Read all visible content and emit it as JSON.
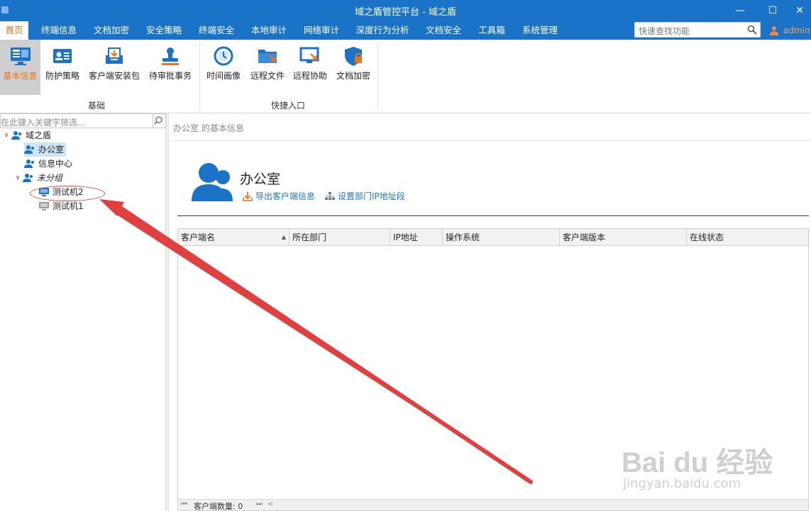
{
  "window": {
    "title": "域之盾管控平台 - 域之盾",
    "minimize": "—",
    "maximize": "☐",
    "close": "✕"
  },
  "menu": {
    "items": [
      {
        "label": "首页",
        "active": true
      },
      {
        "label": "终端信息"
      },
      {
        "label": "文档加密"
      },
      {
        "label": "安全策略"
      },
      {
        "label": "终端安全"
      },
      {
        "label": "本地审计"
      },
      {
        "label": "网络审计"
      },
      {
        "label": "深度行为分析"
      },
      {
        "label": "文档安全"
      },
      {
        "label": "工具箱"
      },
      {
        "label": "系统管理"
      }
    ],
    "search_placeholder": "快速查找功能",
    "user": "admin"
  },
  "ribbon": {
    "buttons": [
      {
        "label": "基本信息",
        "icon": "monitor-info-icon",
        "active": true
      },
      {
        "label": "防护策略",
        "icon": "id-card-icon"
      },
      {
        "label": "客户端安装包",
        "icon": "install-package-icon"
      },
      {
        "label": "待审批事务",
        "icon": "stamp-icon"
      },
      {
        "label": "时间画像",
        "icon": "clock-icon"
      },
      {
        "label": "远程文件",
        "icon": "folder-arrow-icon"
      },
      {
        "label": "远程协助",
        "icon": "remote-screen-icon"
      },
      {
        "label": "文档加密",
        "icon": "shield-lock-icon"
      }
    ],
    "groups": [
      "基础",
      "快捷入口"
    ]
  },
  "left_panel": {
    "filter_placeholder": "在此键入关键字筛选...",
    "tree": [
      {
        "label": "域之盾",
        "level": 0,
        "icon": "group-icon",
        "expanded": true
      },
      {
        "label": "办公室",
        "level": 1,
        "icon": "group-icon",
        "selected": true
      },
      {
        "label": "信息中心",
        "level": 1,
        "icon": "group-icon"
      },
      {
        "label": "未分组",
        "level": 1,
        "icon": "group-icon",
        "expanded": true,
        "italic": true
      },
      {
        "label": "测试机2",
        "level": 2,
        "icon": "computer-online-icon"
      },
      {
        "label": "测试机1",
        "level": 2,
        "icon": "computer-offline-icon"
      }
    ]
  },
  "content": {
    "breadcrumb": "办公室 的基本信息",
    "dept_name": "办公室",
    "links": {
      "export": "导出客户端信息",
      "set_ip": "设置部门IP地址段"
    },
    "table": {
      "columns": [
        "客户端名",
        "所在部门",
        "IP地址",
        "操作系统",
        "客户端版本",
        "在线状态"
      ],
      "rows": [],
      "footer_count": "客户端数量: 0"
    }
  },
  "watermark": {
    "main": "Bai du 经验",
    "sub": "jingyan.baidu.com"
  },
  "colors": {
    "brand_blue": "#1a73c7",
    "accent_orange": "#e8731a",
    "annotation_red": "#e04040"
  }
}
